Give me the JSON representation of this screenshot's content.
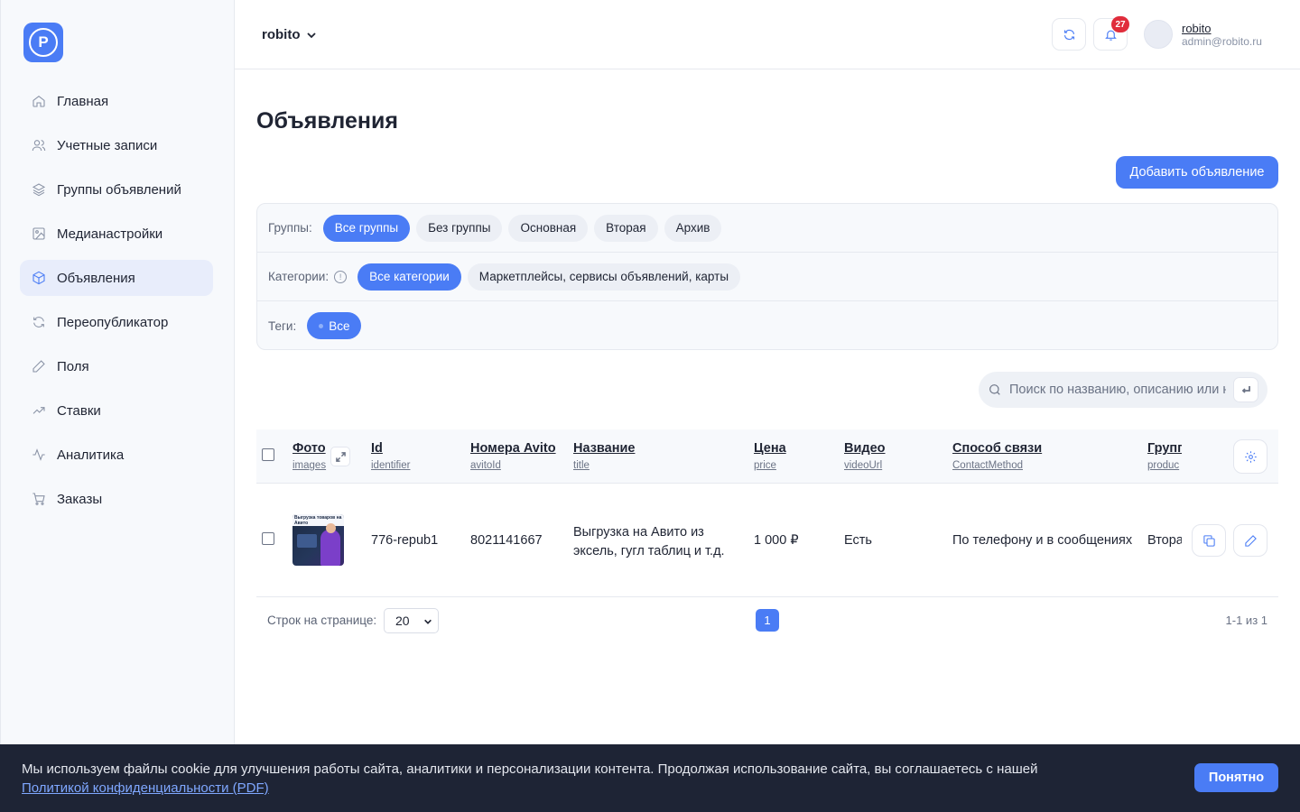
{
  "workspace": {
    "name": "robito"
  },
  "header": {
    "notifications_count": "27",
    "user": {
      "name": "robito",
      "email": "admin@robito.ru"
    }
  },
  "logo": {
    "letter": "P"
  },
  "sidebar": {
    "items": [
      {
        "label": "Главная",
        "icon": "home-icon"
      },
      {
        "label": "Учетные записи",
        "icon": "users-icon"
      },
      {
        "label": "Группы объявлений",
        "icon": "layers-icon"
      },
      {
        "label": "Медианастройки",
        "icon": "image-icon"
      },
      {
        "label": "Объявления",
        "icon": "box-icon",
        "active": true
      },
      {
        "label": "Переопубликатор",
        "icon": "refresh-icon"
      },
      {
        "label": "Поля",
        "icon": "pencil-icon"
      },
      {
        "label": "Ставки",
        "icon": "trending-up-icon"
      },
      {
        "label": "Аналитика",
        "icon": "activity-icon"
      },
      {
        "label": "Заказы",
        "icon": "cart-icon"
      }
    ]
  },
  "main": {
    "title": "Объявления",
    "add_button": "Добавить объявление",
    "filters": {
      "groups": {
        "label": "Группы:",
        "chips": [
          "Все группы",
          "Без группы",
          "Основная",
          "Вторая",
          "Архив"
        ],
        "active": 0
      },
      "categories": {
        "label": "Категории:",
        "chips": [
          "Все категории",
          "Маркетплейсы, сервисы объявлений, карты"
        ],
        "active": 0
      },
      "tags": {
        "label": "Теги:",
        "chips": [
          "Все"
        ],
        "active": 0
      }
    },
    "search": {
      "placeholder": "Поиск по названию, описанию или номеру"
    },
    "table": {
      "columns": [
        {
          "title": "Фото",
          "sub": "images"
        },
        {
          "title": "Id",
          "sub": "identifier"
        },
        {
          "title": "Номера Avito",
          "sub": "avitoId"
        },
        {
          "title": "Название",
          "sub": "title"
        },
        {
          "title": "Цена",
          "sub": "price"
        },
        {
          "title": "Видео",
          "sub": "videoUrl"
        },
        {
          "title": "Способ связи",
          "sub": "ContactMethod"
        },
        {
          "title": "Групп",
          "sub": "produc"
        }
      ],
      "rows": [
        {
          "thumb_text": "Выгрузка товаров на Авито",
          "id": "776-repub1",
          "avito": "8021141667",
          "title": "Выгрузка на Авито из эксель, гугл таблиц и т.д.",
          "price": "1 000 ₽",
          "video": "Есть",
          "contact": "По телефону и в сообщениях",
          "group": "Вторая"
        }
      ]
    },
    "pagination": {
      "rows_label": "Строк на странице:",
      "rows_value": "20",
      "page": "1",
      "range": "1-1 из 1"
    }
  },
  "cookie": {
    "text": "Мы используем файлы cookie для улучшения работы сайта, аналитики и персонализации контента. Продолжая использование сайта, вы соглашаетесь с нашей ",
    "link": "Политикой конфиденциальности (PDF)",
    "button": "Понятно"
  }
}
